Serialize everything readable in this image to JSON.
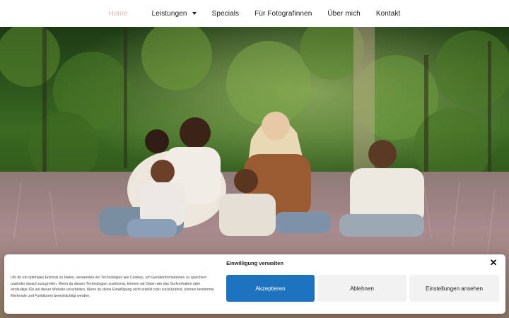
{
  "nav": {
    "items": [
      {
        "label": "Home",
        "active": true
      },
      {
        "label": "Leistungen",
        "dropdown": true
      },
      {
        "label": "Specials"
      },
      {
        "label": "Für Fotografinnen"
      },
      {
        "label": "Über mich"
      },
      {
        "label": "Kontakt"
      }
    ],
    "active_color": "#d9b9b0"
  },
  "hero": {
    "image": "family-sitting-in-heather-field-photo"
  },
  "consent": {
    "title": "Einwilligung verwalten",
    "text": "Um dir ein optimales Erlebnis zu bieten, verwenden wir Technologien wie Cookies, um Geräteinformationen zu speichern und/oder darauf zuzugreifen. Wenn du diesen Technologien zustimmst, können wir Daten wie das Surfverhalten oder eindeutige IDs auf dieser Website verarbeiten. Wenn du deine Einwilligung nicht erteilst oder zurückziehst, können bestimmte Merkmale und Funktionen beeinträchtigt werden.",
    "accept_label": "Akzeptieren",
    "deny_label": "Ablehnen",
    "settings_label": "Einstellungen ansehen",
    "close_icon": "close-icon",
    "accent_color": "#1e73be"
  }
}
